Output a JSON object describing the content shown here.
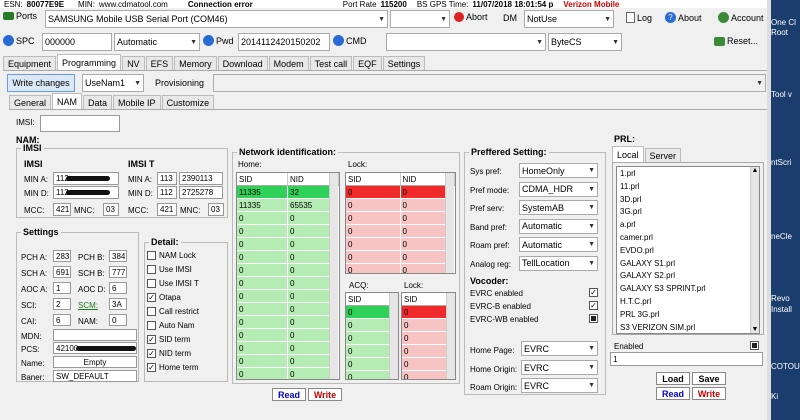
{
  "top": {
    "esn_label": "ESN:",
    "esn_value": "80077E9E",
    "min_label": "MIN:",
    "min_value": "www.cdmatool.com",
    "status": "Connection error",
    "port_rate_label": "Port Rate",
    "port_rate": "115200",
    "bs_gps_label": "BS GPS Time:",
    "gps_time": "11/07/2018 18:01:54 p",
    "brand": "Verizon Mobile"
  },
  "toolbar1": {
    "ports_label": "Ports",
    "port_value": "SAMSUNG Mobile USB Serial Port  (COM46)",
    "abort_label": "Abort",
    "dm_label": "DM",
    "dm_value": "NotUse",
    "log_label": "Log",
    "about_label": "About",
    "account_label": "Account"
  },
  "toolbar2": {
    "spc_label": "SPC",
    "spc_value": "000000",
    "spc_mode": "Automatic",
    "pwd_label": "Pwd",
    "pwd_value": "2014112420150202",
    "cmd_label": "CMD",
    "cmd_value": "",
    "cmd_mode": "ByteCS",
    "reset_label": "Reset..."
  },
  "main_tabs": [
    "Equipment",
    "Programming",
    "NV",
    "EFS",
    "Memory",
    "Download",
    "Modem",
    "Test call",
    "EQF",
    "Settings"
  ],
  "actions": {
    "write_changes": "Write changes",
    "nam_select": "UseNam1",
    "provisioning": "Provisioning"
  },
  "sub_tabs": [
    "General",
    "NAM",
    "Data",
    "Mobile IP",
    "Customize"
  ],
  "imsi": {
    "label": "IMSI:",
    "value": ""
  },
  "nam": {
    "title": "NAM:",
    "imsi_title": "IMSI",
    "imsi": {
      "title": "IMSI",
      "min_a_label": "MIN A:",
      "min_a": "112",
      "min_d_label": "MIN D:",
      "min_d": "112",
      "mcc_label": "MCC:",
      "mcc": "421",
      "mnc_label": "MNC:",
      "mnc": "03"
    },
    "imsi_t": {
      "title": "IMSI T",
      "min_a_label": "MIN A:",
      "min_a_1": "113",
      "min_a_2": "2390113",
      "min_d_label": "MIN D:",
      "min_d_1": "112",
      "min_d_2": "2725278",
      "mcc_label": "MCC:",
      "mcc": "421",
      "mnc_label": "MNC:",
      "mnc": "03"
    }
  },
  "settings": {
    "title": "Settings",
    "pch_a_label": "PCH A:",
    "pch_a": "283",
    "pch_b_label": "PCH B:",
    "pch_b": "384",
    "sch_a_label": "SCH A:",
    "sch_a": "691",
    "sch_b_label": "SCH B:",
    "sch_b": "777",
    "aoc_a_label": "AOC A:",
    "aoc_a": "1",
    "aoc_d_label": "AOC D:",
    "aoc_d": "6",
    "sci_label": "SCI:",
    "sci": "2",
    "scm_label": "SCM:",
    "scm": "3A",
    "cai_label": "CAI:",
    "cai": "6",
    "nam_label": "NAM:",
    "nam": "0",
    "mdn_label": "MDN:",
    "mdn": "",
    "pcs_label": "PCS:",
    "pcs": "42100",
    "name_label": "Name:",
    "name": "Empty",
    "baner_label": "Baner:",
    "baner": "SW_DEFAULT"
  },
  "detail": {
    "title": "Detail:",
    "items": [
      {
        "label": "NAM Lock",
        "checked": false
      },
      {
        "label": "Use IMSI",
        "checked": false
      },
      {
        "label": "Use IMSI T",
        "checked": false
      },
      {
        "label": "Otapa",
        "checked": true
      },
      {
        "label": "Call restrict",
        "checked": false
      },
      {
        "label": "Auto Nam",
        "checked": false
      },
      {
        "label": "SID term",
        "checked": true
      },
      {
        "label": "NID term",
        "checked": true
      },
      {
        "label": "Home term",
        "checked": true
      }
    ]
  },
  "network": {
    "title": "Network identification:",
    "home_label": "Home:",
    "lock_label": "Lock:",
    "acq_label": "ACQ:",
    "lock2_label": "Lock:",
    "sid_header": "SID",
    "nid_header": "NID",
    "home_rows": [
      [
        "11335",
        "32"
      ],
      [
        "11335",
        "65535"
      ],
      [
        "0",
        "0"
      ],
      [
        "0",
        "0"
      ],
      [
        "0",
        "0"
      ],
      [
        "0",
        "0"
      ],
      [
        "0",
        "0"
      ],
      [
        "0",
        "0"
      ],
      [
        "0",
        "0"
      ],
      [
        "0",
        "0"
      ],
      [
        "0",
        "0"
      ],
      [
        "0",
        "0"
      ],
      [
        "0",
        "0"
      ],
      [
        "0",
        "0"
      ],
      [
        "0",
        "0"
      ]
    ],
    "lock_rows": [
      [
        "0",
        "0"
      ],
      [
        "0",
        "0"
      ],
      [
        "0",
        "0"
      ],
      [
        "0",
        "0"
      ],
      [
        "0",
        "0"
      ],
      [
        "0",
        "0"
      ],
      [
        "0",
        "0"
      ]
    ],
    "acq_rows": [
      [
        "0"
      ],
      [
        "0"
      ],
      [
        "0"
      ],
      [
        "0"
      ],
      [
        "0"
      ],
      [
        "0"
      ]
    ],
    "lock2_rows": [
      [
        "0"
      ],
      [
        "0"
      ],
      [
        "0"
      ],
      [
        "0"
      ],
      [
        "0"
      ],
      [
        "0"
      ]
    ],
    "read_label": "Read",
    "write_label": "Write"
  },
  "pref": {
    "title": "Preffered Setting:",
    "sys_pref_label": "Sys pref:",
    "sys_pref": "HomeOnly",
    "pref_mode_label": "Pref mode:",
    "pref_mode": "CDMA_HDR",
    "pref_serv_label": "Pref serv:",
    "pref_serv": "SystemAB",
    "band_pref_label": "Band pref:",
    "band_pref": "Automatic",
    "roam_pref_label": "Roam pref:",
    "roam_pref": "Automatic",
    "analog_reg_label": "Analog reg:",
    "analog_reg": "TellLocation",
    "vocoder_title": "Vocoder:",
    "vocoders": [
      {
        "label": "EVRC enabled",
        "checked": true
      },
      {
        "label": "EVRC-B enabled",
        "checked": true
      },
      {
        "label": "EVRC-WB enabled",
        "checked": true
      }
    ],
    "home_page_label": "Home Page:",
    "home_page": "EVRC",
    "home_origin_label": "Home Origin:",
    "home_origin": "EVRC",
    "roam_origin_label": "Roam Origin:",
    "roam_origin": "EVRC"
  },
  "prl": {
    "title": "PRL:",
    "tabs": [
      "Local",
      "Server"
    ],
    "items": [
      "1.prl",
      "11.prl",
      "3D.prl",
      "3G.prl",
      "a.prl",
      "camer.prl",
      "EVDO.prl",
      "GALAXY S1.prl",
      "GALAXY S2.prl",
      "GALAXY S3 SPRINT.prl",
      "H.T.C.prl",
      "PRL 3G.prl",
      "S3 VERIZON SIM.prl"
    ],
    "enabled_label": "Enabled",
    "value": "1",
    "load_label": "Load",
    "save_label": "Save",
    "read_label": "Read",
    "write_label": "Write"
  },
  "desktop": [
    "One Cl",
    "Root",
    "Tool v",
    "ntScri",
    "neCle",
    "Revo",
    "Install",
    "COTOU",
    "Ki"
  ]
}
